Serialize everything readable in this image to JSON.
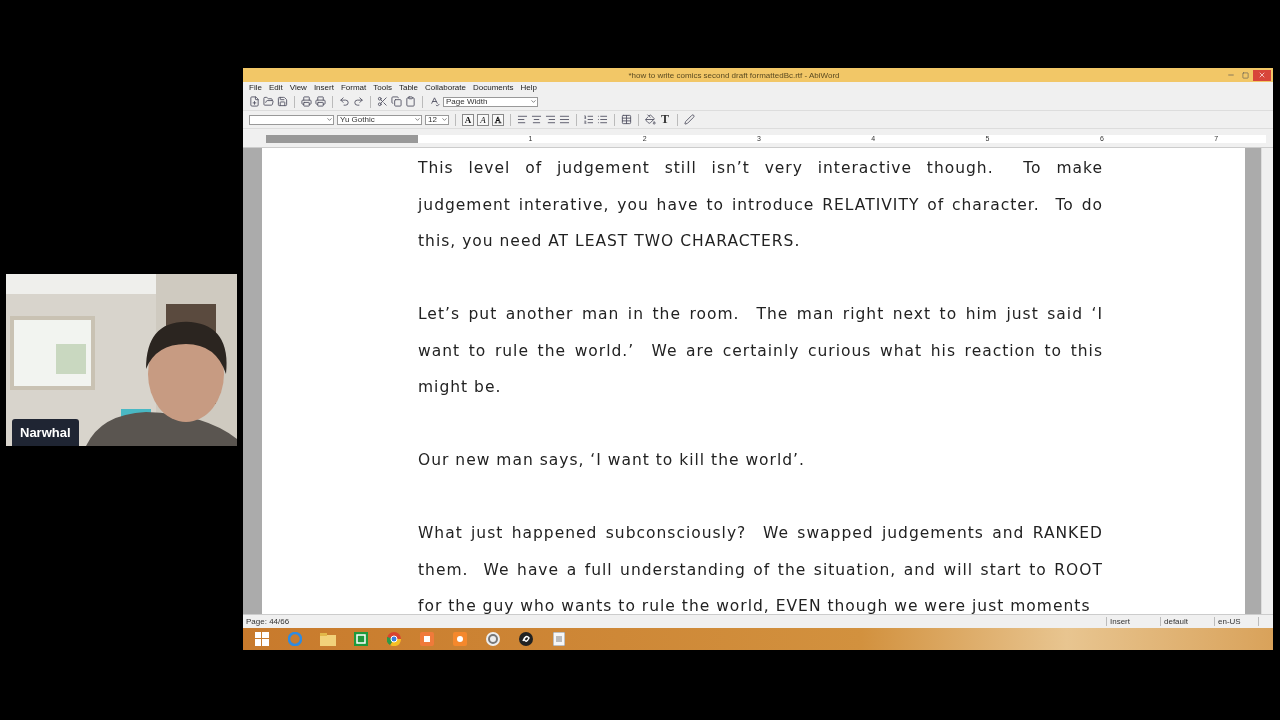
{
  "webcam": {
    "name": "Narwhal"
  },
  "window": {
    "title": "*how to write comics second draft formattedBc.rtf - AbiWord"
  },
  "menu": [
    "File",
    "Edit",
    "View",
    "Insert",
    "Format",
    "Tools",
    "Table",
    "Collaborate",
    "Documents",
    "Help"
  ],
  "toolbar": {
    "zoom": "Page Width"
  },
  "format_bar": {
    "font": "Yu Gothic",
    "size": "12",
    "bold": "A",
    "italic": "A",
    "outline": "A",
    "text_color": "T"
  },
  "ruler": {
    "numbers": [
      "1",
      "2",
      "3",
      "4",
      "5",
      "6",
      "7"
    ]
  },
  "document": {
    "paragraphs": [
      "This level of judgement still isn’t very interactive though.  To make judgement interative, you have to introduce RELATIVITY of character.  To do this, you need AT LEAST TWO CHARACTERS.",
      "Let’s put another man in the room.  The man right next to him just said ‘I want to rule the world.’  We are certainly curious what his reaction to this might be.",
      "Our new man says, ‘I want to kill the world’.",
      "What just happened subconsciously?  We swapped judgements and RANKED them.  We have a full understanding of the situation, and will start to ROOT for the guy who wants to rule the world, EVEN though we were just moments"
    ]
  },
  "status_bar": {
    "page": "Page: 44/66",
    "mode": "Insert",
    "style": "default",
    "language": "en-US"
  },
  "taskbar": [
    {
      "kind": "start"
    },
    {
      "kind": "browser-e"
    },
    {
      "kind": "folder"
    },
    {
      "kind": "sheet"
    },
    {
      "kind": "chrome"
    },
    {
      "kind": "orange"
    },
    {
      "kind": "orange-dot"
    },
    {
      "kind": "spiral"
    },
    {
      "kind": "squiggle"
    },
    {
      "kind": "document"
    }
  ]
}
